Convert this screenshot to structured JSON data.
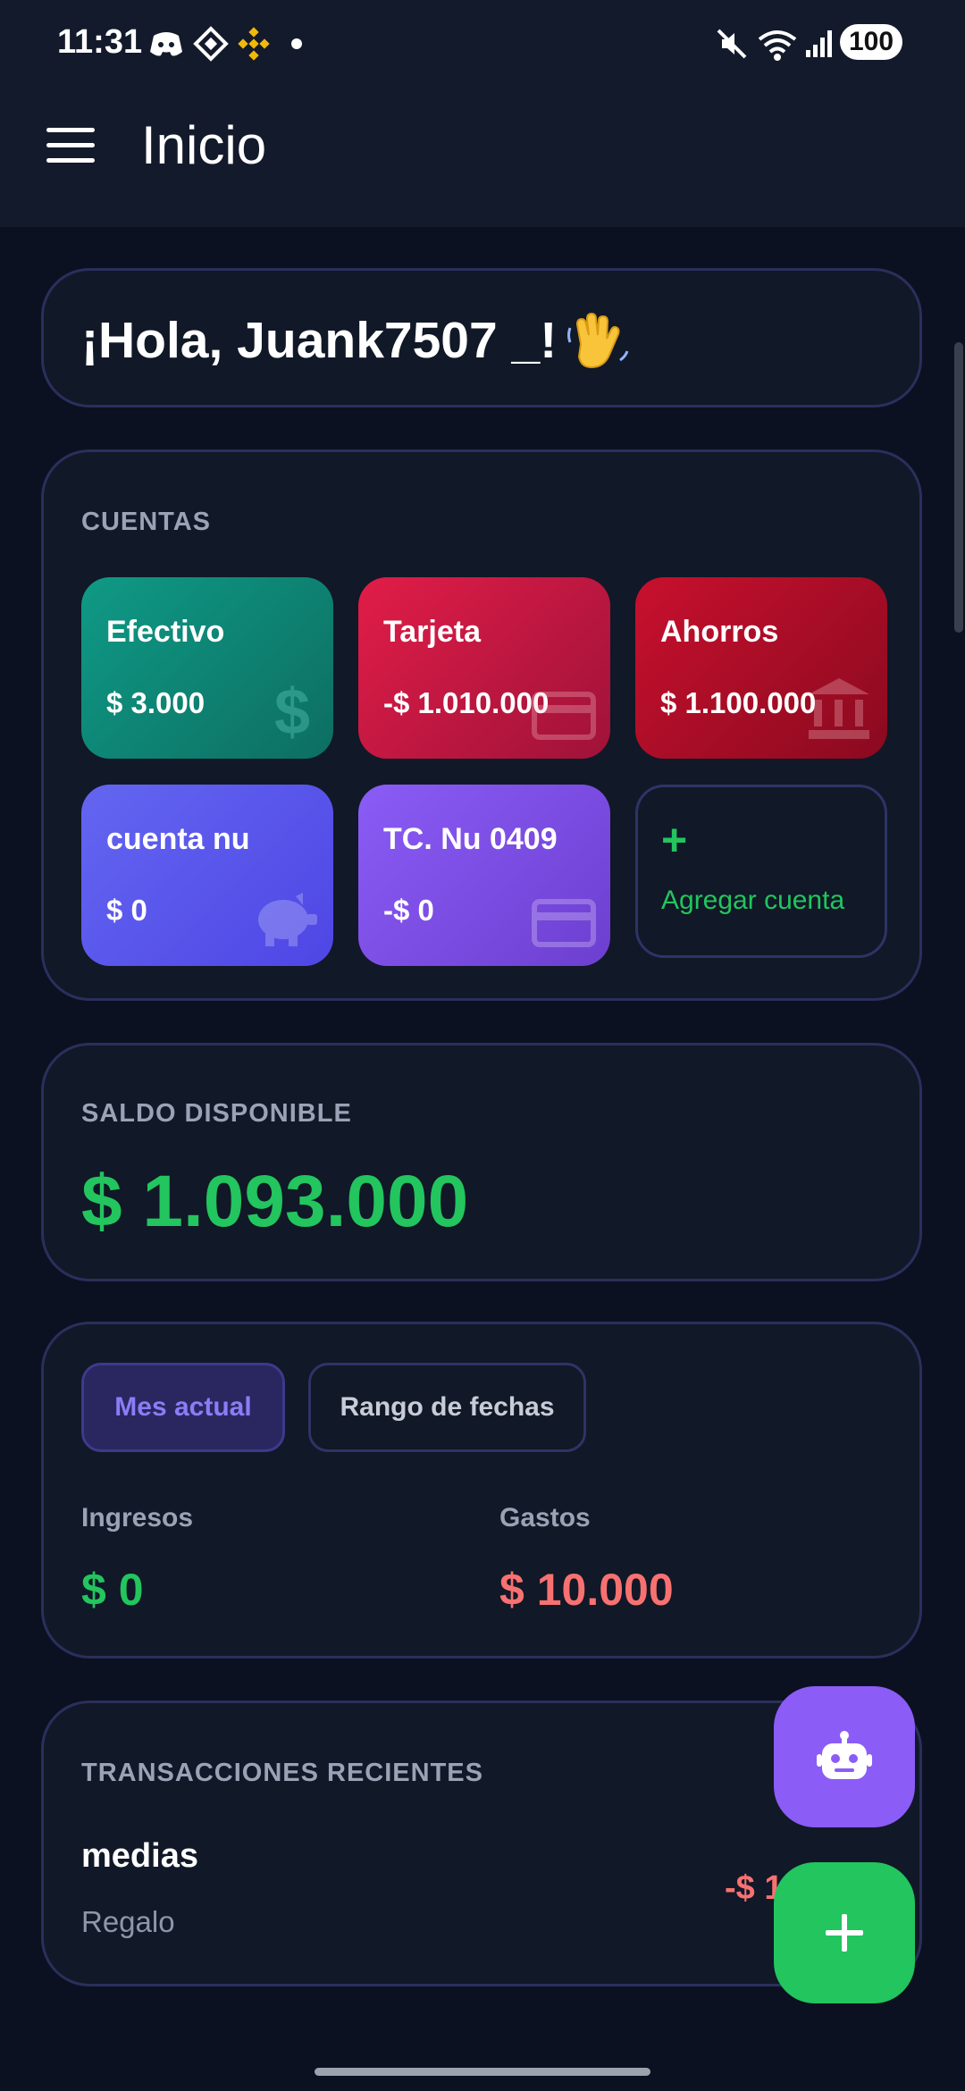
{
  "status_bar": {
    "time": "11:31",
    "battery": "100",
    "icons": [
      "discord-icon",
      "binance-outline-icon",
      "binance-icon",
      "dot-icon",
      "mute-icon",
      "wifi-icon",
      "signal-icon"
    ]
  },
  "app_bar": {
    "title": "Inicio",
    "menu_icon": "hamburger-menu-icon"
  },
  "greeting": {
    "text": "¡Hola, Juank7507 _!",
    "emoji_icon": "waving-hand-icon"
  },
  "accounts": {
    "label": "CUENTAS",
    "items": [
      {
        "name": "Efectivo",
        "value": "$ 3.000",
        "icon": "dollar-icon",
        "color_from": "#0f9a86",
        "color_to": "#0d6e62"
      },
      {
        "name": "Tarjeta",
        "value": "-$ 1.010.000",
        "icon": "credit-card-icon",
        "color_from": "#e11d48",
        "color_to": "#9f1239"
      },
      {
        "name": "Ahorros",
        "value": "$ 1.100.000",
        "icon": "bank-icon",
        "color_from": "#c8102e",
        "color_to": "#8a0a1f"
      },
      {
        "name": "cuenta nu",
        "value": "$ 0",
        "icon": "piggy-bank-icon",
        "color_from": "#6366f1",
        "color_to": "#4f46e5"
      },
      {
        "name": "TC. Nu 0409",
        "value": "-$ 0",
        "icon": "credit-card-icon",
        "color_from": "#8b5cf6",
        "color_to": "#6d3fd0"
      }
    ],
    "add_label": "Agregar cuenta",
    "add_symbol": "+"
  },
  "balance": {
    "label": "SALDO DISPONIBLE",
    "amount": "$ 1.093.000",
    "color": "#22c55e"
  },
  "period": {
    "tabs": [
      "Mes actual",
      "Rango de fechas"
    ],
    "active_tab": "Mes actual",
    "income_label": "Ingresos",
    "income_value": "$ 0",
    "expense_label": "Gastos",
    "expense_value": "$ 10.000",
    "income_color": "#22c55e",
    "expense_color": "#f87171"
  },
  "recent": {
    "label": "TRANSACCIONES RECIENTES",
    "transactions": [
      {
        "title": "medias",
        "category": "Regalo",
        "amount": "-$ 1"
      }
    ]
  },
  "fabs": {
    "assistant_icon": "robot-icon",
    "add_icon": "plus-icon"
  },
  "colors": {
    "background": "#0b1120",
    "card": "#111827",
    "card_border": "#2a2f5c",
    "accent": "#8b5cf6",
    "positive": "#22c55e",
    "negative": "#f87171"
  }
}
